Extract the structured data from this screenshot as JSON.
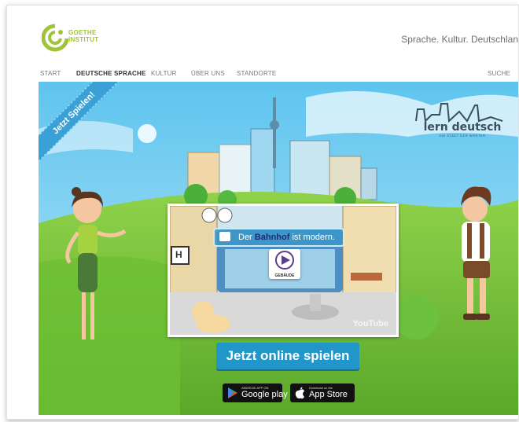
{
  "header": {
    "logo_text_line1": "GOETHE",
    "logo_text_line2": "INSTITUT",
    "tagline": "Sprache. Kultur. Deutschlan"
  },
  "nav": {
    "items": [
      "START",
      "DEUTSCHE SPRACHE",
      "KULTUR",
      "ÜBER UNS",
      "STANDORTE"
    ],
    "active": "DEUTSCHE SPRACHE",
    "search": "SUCHE"
  },
  "hero": {
    "ribbon": "Jetzt Spielen!",
    "brand_title": "lern deutsch",
    "brand_subtitle": "DIE STADT DER WÖRTER",
    "video": {
      "sentence_parts": [
        "Der",
        "Bahnhof",
        "ist modern."
      ],
      "play_label": "GEBÄUDE",
      "sign_letter": "H",
      "youtube_label": "YouTube"
    },
    "cta_label": "Jetzt online spielen",
    "stores": [
      {
        "small": "ANDROID APP ON",
        "big": "Google play",
        "icon": "play-store-icon"
      },
      {
        "small": "Download on the",
        "big": "App Store",
        "icon": "apple-icon"
      }
    ]
  },
  "colors": {
    "brand_green": "#9fc43a",
    "cta_blue": "#2196c9",
    "ribbon_blue": "#3aa0d6",
    "sky": "#7fd0f0",
    "grass": "#7cc43c"
  }
}
